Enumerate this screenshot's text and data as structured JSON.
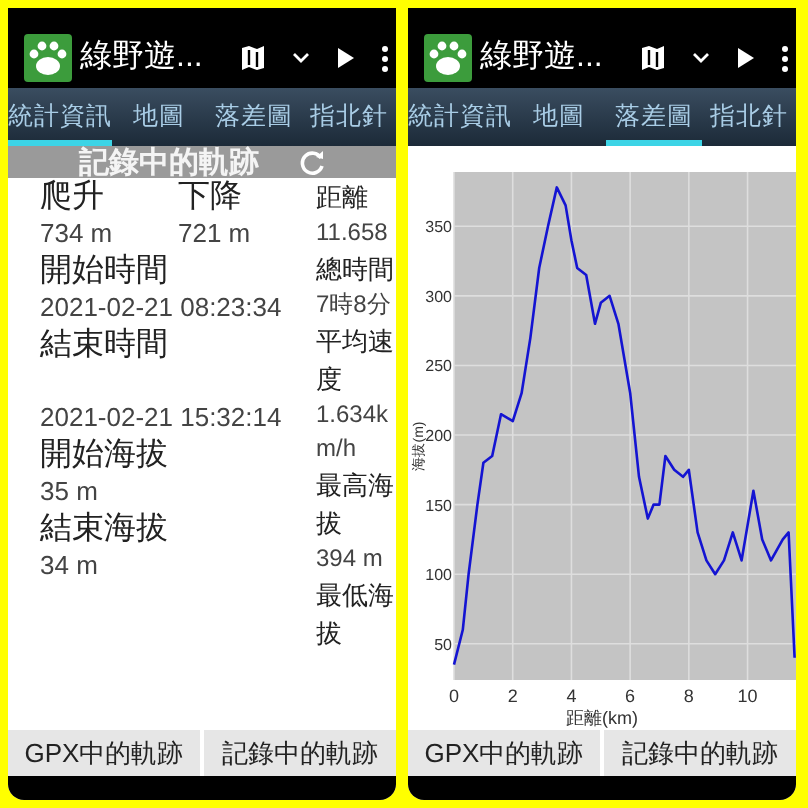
{
  "panels": [
    {
      "app_bar": {
        "title": "綠野遊..."
      },
      "tabs": [
        {
          "label": "統計資訊",
          "selected": true
        },
        {
          "label": "地圖",
          "selected": false
        },
        {
          "label": "落差圖",
          "selected": false
        },
        {
          "label": "指北針",
          "selected": false
        }
      ],
      "content": {
        "kind": "stats",
        "header": "記錄中的軌跡",
        "top_row": [
          {
            "label": "爬升",
            "value": "734 m"
          },
          {
            "label": "下降",
            "value": "721 m"
          }
        ],
        "left_items": [
          {
            "label": "開始時間",
            "value": "2021-02-21 08:23:34"
          },
          {
            "label": "結束時間",
            "value": "2021-02-21 15:32:14"
          },
          {
            "label": "開始海拔",
            "value": "35 m"
          },
          {
            "label": "結束海拔",
            "value": "34 m"
          }
        ],
        "right_items": [
          {
            "label": "距離",
            "value": "11.658"
          },
          {
            "label": "總時間",
            "value": "7時8分"
          },
          {
            "label": "平均速度",
            "value": "1.634km/h"
          },
          {
            "label": "最高海拔",
            "value": "394 m"
          },
          {
            "label": "最低海拔"
          }
        ]
      },
      "bottom_buttons": [
        {
          "label": "GPX中的軌跡"
        },
        {
          "label": "記錄中的軌跡"
        }
      ]
    },
    {
      "app_bar": {
        "title": "綠野遊..."
      },
      "tabs": [
        {
          "label": "統計資訊",
          "selected": false
        },
        {
          "label": "地圖",
          "selected": false
        },
        {
          "label": "落差圖",
          "selected": true
        },
        {
          "label": "指北針",
          "selected": false
        }
      ],
      "content": {
        "kind": "chart",
        "chart_data": {
          "type": "line",
          "xlabel": "距離(km)",
          "ylabel": "海拔(m)",
          "x": [
            0,
            0.3,
            0.5,
            0.8,
            1.0,
            1.3,
            1.6,
            2.0,
            2.3,
            2.6,
            2.9,
            3.2,
            3.5,
            3.8,
            4.0,
            4.2,
            4.5,
            4.8,
            5.0,
            5.3,
            5.6,
            6.0,
            6.3,
            6.6,
            6.8,
            7.0,
            7.2,
            7.5,
            7.8,
            8.0,
            8.3,
            8.6,
            8.9,
            9.2,
            9.5,
            9.8,
            10.2,
            10.5,
            10.8,
            11.2,
            11.4,
            11.6
          ],
          "series": [
            {
              "color": "#1414d2",
              "values": [
                35,
                60,
                100,
                150,
                180,
                185,
                215,
                210,
                230,
                270,
                320,
                350,
                378,
                365,
                340,
                320,
                315,
                280,
                295,
                300,
                280,
                230,
                170,
                140,
                150,
                150,
                185,
                175,
                170,
                175,
                130,
                110,
                100,
                110,
                130,
                110,
                160,
                125,
                110,
                125,
                130,
                40
              ]
            }
          ],
          "grid": true,
          "xlim": [
            0,
            11.65
          ],
          "ylim": [
            24,
            389
          ],
          "xticks": [
            0,
            2,
            4,
            6,
            8,
            10
          ],
          "yticks": [
            50,
            100,
            150,
            200,
            250,
            300,
            350
          ]
        }
      },
      "bottom_buttons": [
        {
          "label": "GPX中的軌跡"
        },
        {
          "label": "記錄中的軌跡"
        }
      ]
    }
  ]
}
